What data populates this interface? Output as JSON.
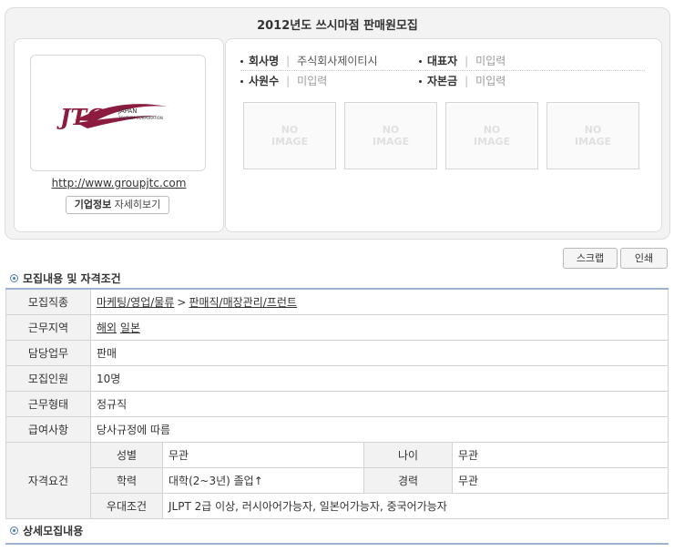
{
  "header": {
    "title": "2012년도 쓰시마점 판매원모집"
  },
  "company": {
    "logo_text_main": "JTC",
    "logo_text_sub1": "JAPAN",
    "logo_text_sub2": "TOURISM CORPORATION",
    "url": "http://www.groupjtc.com",
    "info_button_bold": "기업정보",
    "info_button_rest": " 자세히보기",
    "brand_color": "#8b1c3f",
    "fields": [
      {
        "label": "회사명",
        "value": "주식회사제이티시"
      },
      {
        "label": "대표자",
        "value": "미입력"
      },
      {
        "label": "사원수",
        "value": "미입력"
      },
      {
        "label": "자본금",
        "value": "미입력"
      }
    ],
    "images": [
      "NO IMAGE",
      "NO IMAGE",
      "NO IMAGE",
      "NO IMAGE"
    ]
  },
  "actions": {
    "scrap": "스크랩",
    "print": "인쇄"
  },
  "section1": {
    "title": "모집내용 및 자격조건"
  },
  "table": {
    "job_type": {
      "label": "모집직종",
      "value_a": "마케팅/영업/물류",
      "arrow": ">",
      "value_b": "판매직/매장관리/프런트"
    },
    "region": {
      "label": "근무지역",
      "value_a": "해외",
      "value_b": "일본"
    },
    "duty": {
      "label": "담당업무",
      "value": "판매"
    },
    "headcount": {
      "label": "모집인원",
      "value": "10명"
    },
    "employment": {
      "label": "근무형태",
      "value": "정규직"
    },
    "salary": {
      "label": "급여사항",
      "value": "당사규정에 따름"
    },
    "qual": {
      "label": "자격요건",
      "gender_label": "성별",
      "gender": "무관",
      "age_label": "나이",
      "age": "무관",
      "edu_label": "학력",
      "edu": "대학(2~3년) 졸업↑",
      "career_label": "경력",
      "career": "무관",
      "pref_label": "우대조건",
      "pref": "JLPT 2급 이상, 러시아어가능자, 일본어가능자, 중국어가능자"
    }
  },
  "section2": {
    "title": "상세모집내용"
  }
}
